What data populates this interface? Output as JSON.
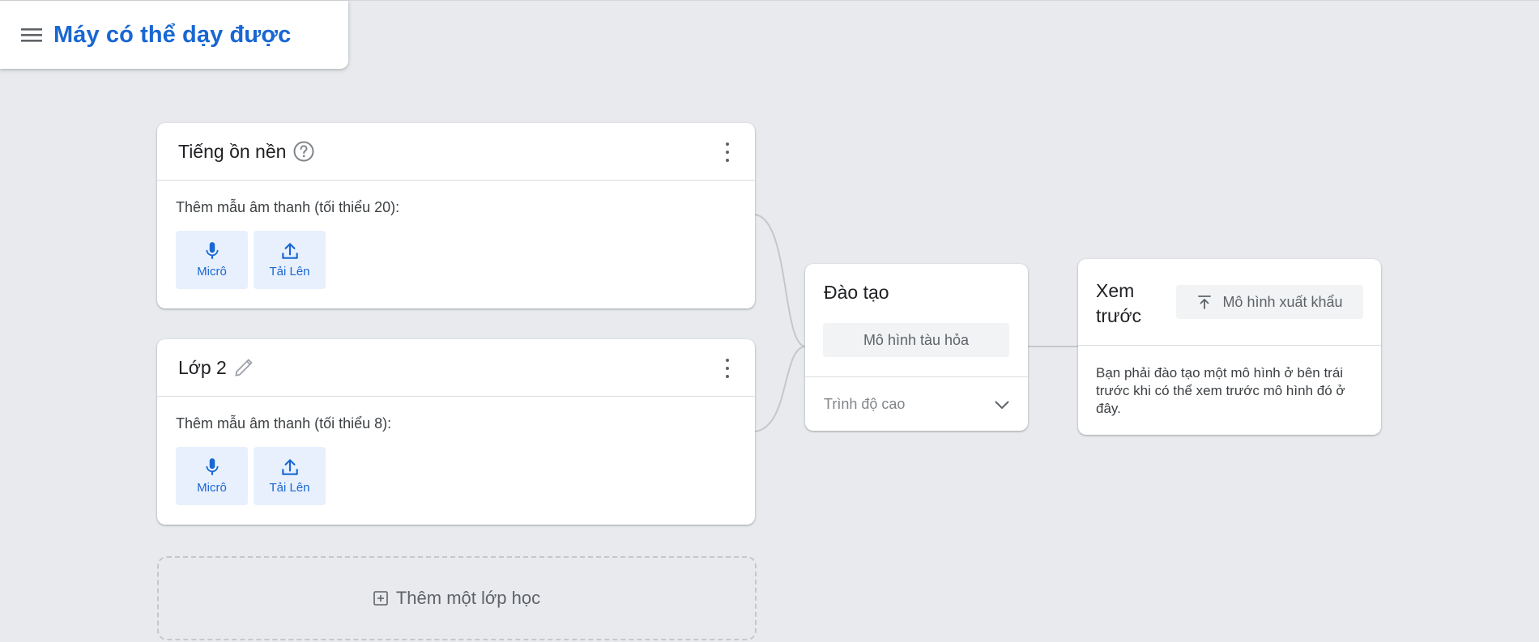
{
  "app": {
    "title": "Máy có thể dạy được",
    "menu_icon": "menu-icon"
  },
  "classes": [
    {
      "name": "Tiếng ồn nền",
      "title_icon": "help-icon",
      "samples_label": "Thêm mẫu âm thanh (tối thiểu 20):",
      "mic_label": "Micrô",
      "upload_label": "Tải Lên"
    },
    {
      "name": "Lớp 2",
      "title_icon": "edit-icon",
      "samples_label": "Thêm mẫu âm thanh (tối thiểu 8):",
      "mic_label": "Micrô",
      "upload_label": "Tải Lên"
    }
  ],
  "add_class_label": "Thêm một lớp học",
  "training": {
    "title": "Đào tạo",
    "train_button": "Mô hình tàu hỏa",
    "advanced_label": "Trình độ cao"
  },
  "preview": {
    "title": "Xem trước",
    "export_button": "Mô hình xuất khẩu",
    "message": "Bạn phải đào tạo một mô hình ở bên trái trước khi có thể xem trước mô hình đó ở đây."
  },
  "colors": {
    "accent": "#1967d2",
    "background": "#e8eaed",
    "source_button_bg": "#e8f0fe"
  }
}
